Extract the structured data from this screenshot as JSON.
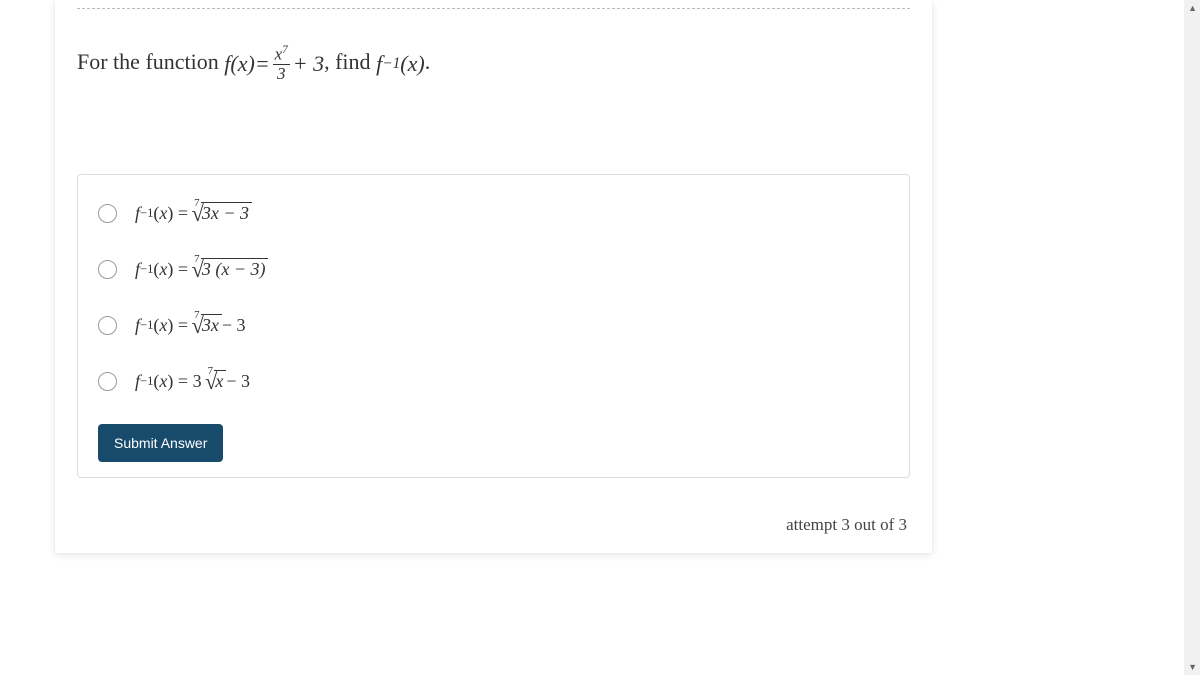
{
  "question": {
    "prefix": "For the function ",
    "func_lhs_f": "f",
    "func_lhs_paren_open": "(",
    "func_lhs_x": "x",
    "func_lhs_paren_close": ")",
    "equals": " = ",
    "frac_numerator_x": "x",
    "frac_numerator_exp": "7",
    "frac_denominator": "3",
    "plus3": " + 3",
    "mid": ", find ",
    "finv_f": "f",
    "finv_exp": "−1",
    "finv_open": "(",
    "finv_x": "x",
    "finv_close": ")",
    "period": "."
  },
  "options": {
    "a": {
      "lhs_f": "f",
      "lhs_exp": "−1",
      "lhs_open": "(",
      "lhs_x": "x",
      "lhs_close": ") = ",
      "root_index": "7",
      "radicand": "3x − 3",
      "tail": ""
    },
    "b": {
      "lhs_f": "f",
      "lhs_exp": "−1",
      "lhs_open": "(",
      "lhs_x": "x",
      "lhs_close": ") = ",
      "root_index": "7",
      "radicand": "3 (x − 3)",
      "tail": ""
    },
    "c": {
      "lhs_f": "f",
      "lhs_exp": "−1",
      "lhs_open": "(",
      "lhs_x": "x",
      "lhs_close": ") = ",
      "root_index": "7",
      "radicand": "3x",
      "tail": " − 3"
    },
    "d": {
      "lhs_f": "f",
      "lhs_exp": "−1",
      "lhs_open": "(",
      "lhs_x": "x",
      "lhs_close": ") = 3",
      "root_index": "7",
      "radicand": "x",
      "tail": " − 3"
    }
  },
  "submit_label": "Submit Answer",
  "attempt_text": "attempt 3 out of 3"
}
